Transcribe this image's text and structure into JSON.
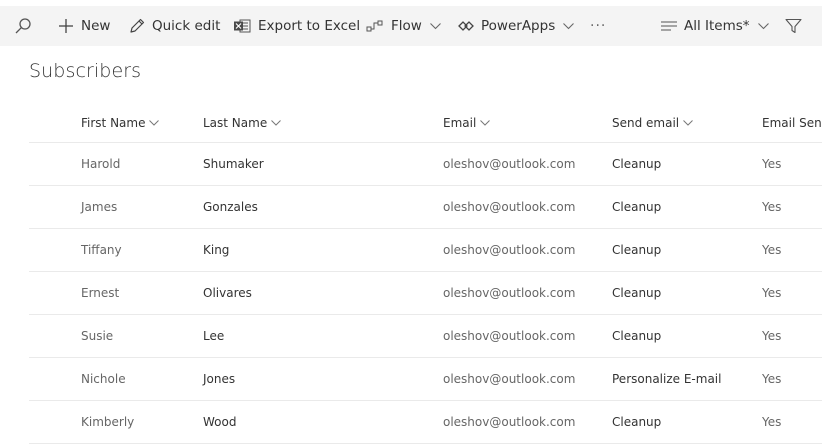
{
  "toolbar": {
    "new_label": "New",
    "quick_edit_label": "Quick edit",
    "export_label": "Export to Excel",
    "flow_label": "Flow",
    "powerapps_label": "PowerApps",
    "more_label": "···",
    "view_label": "All Items*"
  },
  "page": {
    "title": "Subscribers"
  },
  "table": {
    "columns": [
      "First Name",
      "Last Name",
      "Email",
      "Send email",
      "Email Sent"
    ],
    "rows": [
      [
        "Harold",
        "Shumaker",
        "oleshov@outlook.com",
        "Cleanup",
        "Yes"
      ],
      [
        "James",
        "Gonzales",
        "oleshov@outlook.com",
        "Cleanup",
        "Yes"
      ],
      [
        "Tiffany",
        "King",
        "oleshov@outlook.com",
        "Cleanup",
        "Yes"
      ],
      [
        "Ernest",
        "Olivares",
        "oleshov@outlook.com",
        "Cleanup",
        "Yes"
      ],
      [
        "Susie",
        "Lee",
        "oleshov@outlook.com",
        "Cleanup",
        "Yes"
      ],
      [
        "Nichole",
        "Jones",
        "oleshov@outlook.com",
        "Personalize E-mail",
        "Yes"
      ],
      [
        "Kimberly",
        "Wood",
        "oleshov@outlook.com",
        "Cleanup",
        "Yes"
      ]
    ]
  },
  "icons": {
    "search": "search-icon",
    "new": "plus-icon",
    "quick_edit": "pencil-icon",
    "export": "excel-icon",
    "flow": "flow-icon",
    "powerapps": "powerapps-icon",
    "view": "view-lines-icon",
    "filter": "filter-icon",
    "sort": "chevron-down-icon"
  },
  "colors": {
    "command_bar_bg": "#f4f4f4",
    "text_primary": "#333333",
    "text_secondary": "#666666",
    "divider": "#eaeaea"
  }
}
